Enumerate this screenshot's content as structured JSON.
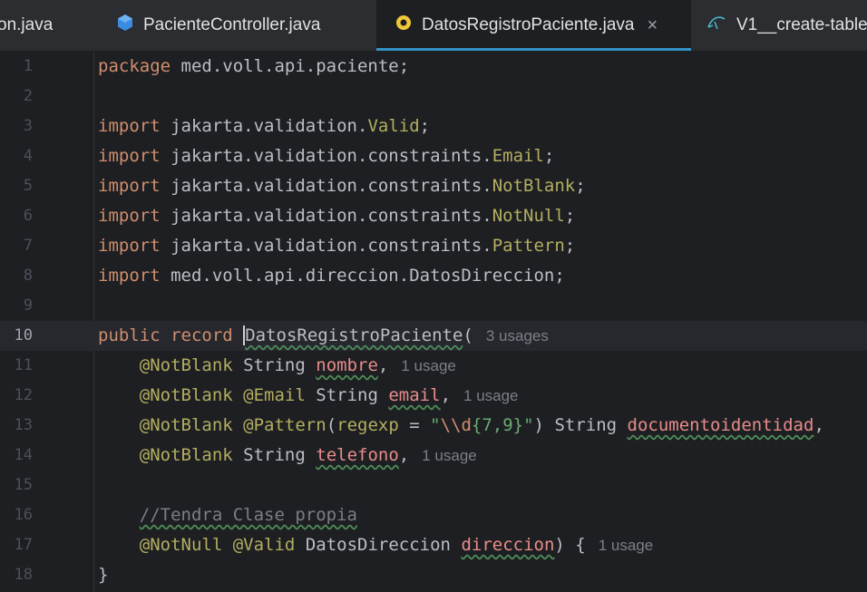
{
  "tabs": [
    {
      "label": "on.java",
      "icon": "java-class-icon"
    },
    {
      "label": "PacienteController.java",
      "icon": "java-class-icon"
    },
    {
      "label": "DatosRegistroPaciente.java",
      "icon": "java-record-icon",
      "active": true,
      "close": "×"
    },
    {
      "label": "V1__create-table",
      "icon": "sql-file-icon"
    }
  ],
  "lines": [
    {
      "num": "1",
      "parts": [
        [
          "kw",
          "package"
        ],
        [
          "",
          "med.voll.api.paciente;"
        ]
      ]
    },
    {
      "num": "2",
      "parts": []
    },
    {
      "num": "3",
      "parts": [
        [
          "kw",
          "import"
        ],
        [
          "",
          "jakarta.validation."
        ],
        [
          "cls",
          "Valid"
        ],
        [
          "",
          ";"
        ]
      ]
    },
    {
      "num": "4",
      "parts": [
        [
          "kw",
          "import"
        ],
        [
          "",
          "jakarta.validation.constraints."
        ],
        [
          "cls",
          "Email"
        ],
        [
          "",
          ";"
        ]
      ]
    },
    {
      "num": "5",
      "parts": [
        [
          "kw",
          "import"
        ],
        [
          "",
          "jakarta.validation.constraints."
        ],
        [
          "cls",
          "NotBlank"
        ],
        [
          "",
          ";"
        ]
      ]
    },
    {
      "num": "6",
      "parts": [
        [
          "kw",
          "import"
        ],
        [
          "",
          "jakarta.validation.constraints."
        ],
        [
          "cls",
          "NotNull"
        ],
        [
          "",
          ";"
        ]
      ]
    },
    {
      "num": "7",
      "parts": [
        [
          "kw",
          "import"
        ],
        [
          "",
          "jakarta.validation.constraints."
        ],
        [
          "cls",
          "Pattern"
        ],
        [
          "",
          ";"
        ]
      ]
    },
    {
      "num": "8",
      "parts": [
        [
          "kw",
          "import"
        ],
        [
          "",
          "med.voll.api.direccion.DatosDireccion;"
        ]
      ]
    },
    {
      "num": "9",
      "parts": []
    },
    {
      "num": "10",
      "current": true,
      "parts": [
        [
          "kw",
          "public"
        ],
        [
          "kw",
          "record"
        ],
        [
          "name-hl",
          "DatosRegistroPaciente"
        ],
        [
          "",
          "("
        ],
        [
          "hint",
          "3 usages"
        ]
      ]
    },
    {
      "num": "11",
      "parts": [
        [
          "",
          "    "
        ],
        [
          "ann",
          "@NotBlank"
        ],
        [
          "",
          "String"
        ],
        [
          "param",
          "nombre"
        ],
        [
          "",
          ","
        ],
        [
          "hint",
          "1 usage"
        ]
      ]
    },
    {
      "num": "12",
      "parts": [
        [
          "",
          "    "
        ],
        [
          "ann",
          "@NotBlank"
        ],
        [
          "ann",
          "@Email"
        ],
        [
          "",
          "String"
        ],
        [
          "param",
          "email"
        ],
        [
          "",
          ","
        ],
        [
          "hint",
          "1 usage"
        ]
      ]
    },
    {
      "num": "13",
      "parts": [
        [
          "",
          "    "
        ],
        [
          "ann",
          "@NotBlank"
        ],
        [
          "ann",
          "@Pattern"
        ],
        [
          "",
          "("
        ],
        [
          "ann",
          "regexp"
        ],
        [
          "",
          " = "
        ],
        [
          "str",
          "\""
        ],
        [
          "esc",
          "\\\\d"
        ],
        [
          "str",
          "{7,9}\""
        ],
        [
          "",
          ")"
        ],
        [
          "",
          "String"
        ],
        [
          "param",
          "documentoidentidad"
        ],
        [
          "",
          ","
        ]
      ]
    },
    {
      "num": "14",
      "parts": [
        [
          "",
          "    "
        ],
        [
          "ann",
          "@NotBlank"
        ],
        [
          "",
          "String"
        ],
        [
          "param",
          "telefono"
        ],
        [
          "",
          ","
        ],
        [
          "hint",
          "1 usage"
        ]
      ]
    },
    {
      "num": "15",
      "parts": []
    },
    {
      "num": "16",
      "parts": [
        [
          "",
          "    "
        ],
        [
          "cm",
          "//Tendra Clase propia"
        ]
      ]
    },
    {
      "num": "17",
      "parts": [
        [
          "",
          "    "
        ],
        [
          "ann",
          "@NotNull"
        ],
        [
          "ann",
          "@Valid"
        ],
        [
          "",
          "DatosDireccion"
        ],
        [
          "param",
          "direccion"
        ],
        [
          "",
          ") {"
        ],
        [
          "hint",
          "1 usage"
        ]
      ]
    },
    {
      "num": "18",
      "parts": [
        [
          "",
          "}"
        ]
      ]
    }
  ]
}
